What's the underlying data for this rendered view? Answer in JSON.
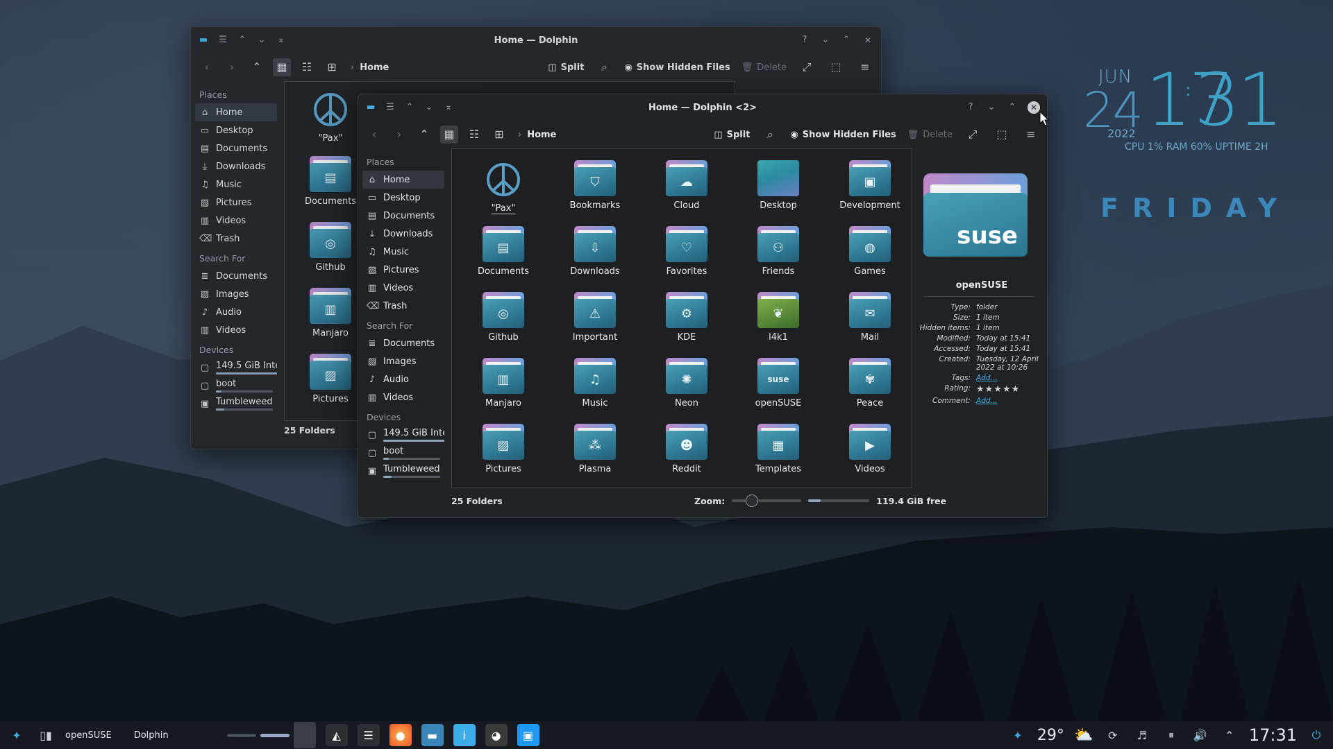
{
  "clock": {
    "month": "JUN",
    "day": "24",
    "hour": "17",
    "minute": "31",
    "year": "2022",
    "stats": "CPU 1%  RAM 60%  UPTIME 2H",
    "weekday": "FRIDAY"
  },
  "colors": {
    "accent": "#3daee9",
    "folder_front": "#2f7894",
    "folder_back": "#c089c9",
    "window_bg": "#202326"
  },
  "back_window": {
    "title": "Home — Dolphin",
    "breadcrumb": "Home",
    "toolbar": {
      "split": "Split",
      "hidden": "Show Hidden Files",
      "delete": "Delete"
    },
    "sidebar": {
      "places_head": "Places",
      "places": [
        {
          "label": "Home",
          "icon": "home-icon"
        },
        {
          "label": "Desktop",
          "icon": "desktop-icon"
        },
        {
          "label": "Documents",
          "icon": "document-icon"
        },
        {
          "label": "Downloads",
          "icon": "download-icon"
        },
        {
          "label": "Music",
          "icon": "music-icon"
        },
        {
          "label": "Pictures",
          "icon": "picture-icon"
        },
        {
          "label": "Videos",
          "icon": "video-icon"
        },
        {
          "label": "Trash",
          "icon": "trash-icon"
        }
      ],
      "search_head": "Search For",
      "search": [
        {
          "label": "Documents",
          "icon": "document-icon"
        },
        {
          "label": "Images",
          "icon": "image-icon"
        },
        {
          "label": "Audio",
          "icon": "audio-icon"
        },
        {
          "label": "Videos",
          "icon": "video-icon"
        }
      ],
      "devices_head": "Devices",
      "devices": [
        {
          "label": "149.5 GiB Inte...",
          "fill": 0.85
        },
        {
          "label": "boot",
          "fill": 0.1
        },
        {
          "label": "Tumbleweed",
          "fill": 0.15
        }
      ]
    },
    "items": [
      "\"Pax\"",
      "Documents",
      "Github",
      "Manjaro",
      "Pictures"
    ],
    "status": "25 Folders"
  },
  "front_window": {
    "title": "Home — Dolphin <2>",
    "breadcrumb": "Home",
    "toolbar": {
      "split": "Split",
      "hidden": "Show Hidden Files",
      "delete": "Delete"
    },
    "sidebar": {
      "places_head": "Places",
      "places": [
        {
          "label": "Home"
        },
        {
          "label": "Desktop"
        },
        {
          "label": "Documents"
        },
        {
          "label": "Downloads"
        },
        {
          "label": "Music"
        },
        {
          "label": "Pictures"
        },
        {
          "label": "Videos"
        },
        {
          "label": "Trash"
        }
      ],
      "search_head": "Search For",
      "search": [
        {
          "label": "Documents"
        },
        {
          "label": "Images"
        },
        {
          "label": "Audio"
        },
        {
          "label": "Videos"
        }
      ],
      "devices_head": "Devices",
      "devices": [
        {
          "label": "149.5 GiB Inte...",
          "fill": 0.85
        },
        {
          "label": "boot",
          "fill": 0.1
        },
        {
          "label": "Tumbleweed",
          "fill": 0.15
        }
      ]
    },
    "folders": [
      {
        "label": "\"Pax\"",
        "icon": "peace-icon"
      },
      {
        "label": "Bookmarks",
        "icon": "bookmark-icon"
      },
      {
        "label": "Cloud",
        "icon": "cloud-icon"
      },
      {
        "label": "Desktop",
        "icon": "desktop-icon"
      },
      {
        "label": "Development",
        "icon": "development-icon"
      },
      {
        "label": "Documents",
        "icon": "document-icon"
      },
      {
        "label": "Downloads",
        "icon": "download-icon"
      },
      {
        "label": "Favorites",
        "icon": "heart-icon"
      },
      {
        "label": "Friends",
        "icon": "friends-icon"
      },
      {
        "label": "Games",
        "icon": "gamepad-icon"
      },
      {
        "label": "Github",
        "icon": "github-icon"
      },
      {
        "label": "Important",
        "icon": "warning-icon"
      },
      {
        "label": "KDE",
        "icon": "kde-icon"
      },
      {
        "label": "l4k1",
        "icon": "chameleon-icon"
      },
      {
        "label": "Mail",
        "icon": "mail-icon"
      },
      {
        "label": "Manjaro",
        "icon": "manjaro-icon"
      },
      {
        "label": "Music",
        "icon": "music-icon"
      },
      {
        "label": "Neon",
        "icon": "neon-icon"
      },
      {
        "label": "openSUSE",
        "icon": "suse-icon"
      },
      {
        "label": "Peace",
        "icon": "leaf-icon"
      },
      {
        "label": "Pictures",
        "icon": "picture-icon"
      },
      {
        "label": "Plasma",
        "icon": "plasma-icon"
      },
      {
        "label": "Reddit",
        "icon": "reddit-icon"
      },
      {
        "label": "Templates",
        "icon": "template-icon"
      },
      {
        "label": "Videos",
        "icon": "video-icon"
      }
    ],
    "info": {
      "name": "openSUSE",
      "badge": "suse",
      "rows": [
        {
          "k": "Type:",
          "v": "folder"
        },
        {
          "k": "Size:",
          "v": "1 item"
        },
        {
          "k": "Hidden items:",
          "v": "1 item"
        },
        {
          "k": "Modified:",
          "v": "Today at 15:41"
        },
        {
          "k": "Accessed:",
          "v": "Today at 15:41"
        },
        {
          "k": "Created:",
          "v": "Tuesday, 12 April 2022 at 10:26"
        }
      ],
      "tags_k": "Tags:",
      "tags_v": "Add...",
      "rating_k": "Rating:",
      "rating": 5,
      "comment_k": "Comment:",
      "comment_v": "Add..."
    },
    "status": {
      "count": "25 Folders",
      "zoom_label": "Zoom:",
      "zoom_level": 0.2,
      "free": "119.4 GiB free",
      "used_fraction": 0.2
    }
  },
  "taskbar": {
    "task1": "openSUSE",
    "task2": "Dolphin",
    "temperature": "29°",
    "time": "17:31"
  }
}
